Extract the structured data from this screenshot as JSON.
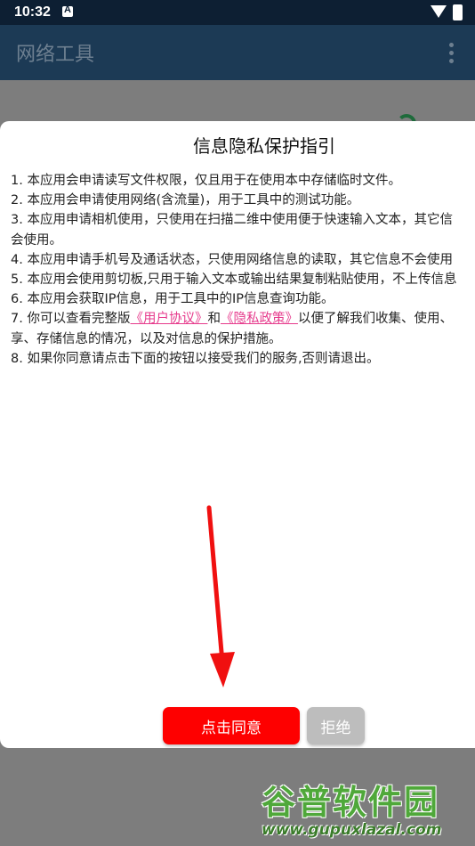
{
  "status_bar": {
    "time": "10:32"
  },
  "app_bar": {
    "title": "网络工具",
    "menu_icon": "more-vertical-icon"
  },
  "dialog": {
    "title": "信息隐私保护指引",
    "items": [
      "1. 本应用会申请读写文件权限，仅且用于在使用本中存储临时文件。",
      "2. 本应用会申请使用网络(含流量)，用于工具中的测试功能。",
      "3. 本应用申请相机使用，只使用在扫描二维中使用便于快速输入文本，其它信",
      "会使用。",
      "4. 本应用申请手机号及通话状态，只使用网络信息的读取，其它信息不会使用",
      "5. 本应用会使用剪切板,只用于输入文本或输出结果复制粘贴使用，不上传信息",
      "6. 本应用会获取IP信息，用于工具中的IP信息查询功能。"
    ],
    "item7_prefix": "7. 你可以查看完整版",
    "user_agreement_link": "《用户协议》",
    "item7_and": "和",
    "privacy_policy_link": "《隐私政策》",
    "item7_suffix": "以便了解我们收集、使用、",
    "item7_line2": "享、存储信息的情况，以及对信息的保护措施。",
    "item8": "8. 如果你同意请点击下面的按钮以接受我们的服务,否则请退出。",
    "agree_label": "点击同意",
    "reject_label": "拒绝"
  },
  "watermark": {
    "name": "谷普软件园",
    "url": "www.gupuxlazal.com"
  },
  "colors": {
    "agree_button": "#fe0000",
    "reject_button": "#bdbdbd",
    "link": "#e63a8c",
    "status_bar": "#0d1f33",
    "app_bar": "#1c3a55"
  }
}
